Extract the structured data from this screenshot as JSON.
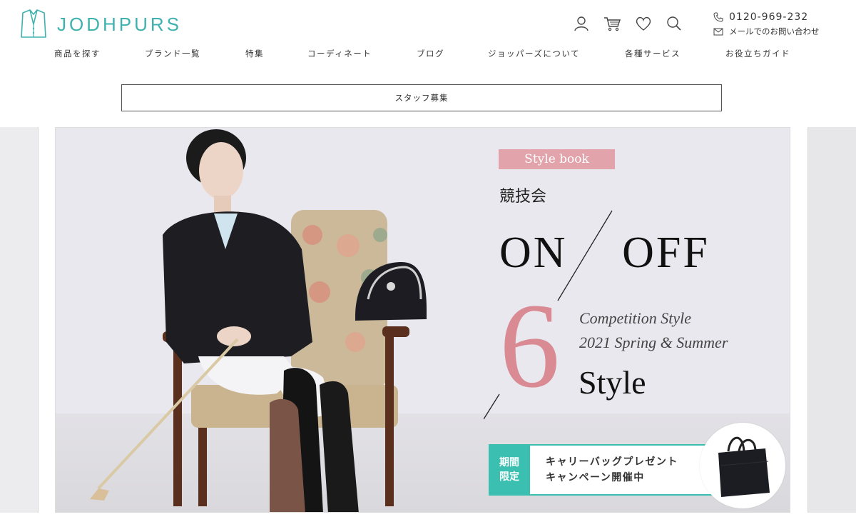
{
  "header": {
    "logo_text": "JODHPURS",
    "icons": [
      "user-icon",
      "cart-icon",
      "heart-icon",
      "search-icon"
    ],
    "phone": "0120-969-232",
    "mail_label": "メールでのお問い合わせ"
  },
  "nav": {
    "items": [
      "商品を探す",
      "ブランド一覧",
      "特集",
      "コーディネート",
      "ブログ",
      "ジョッパーズについて",
      "各種サービス",
      "お役立ちガイド"
    ]
  },
  "staff_button": "スタッフ募集",
  "slide": {
    "badge": "Style book",
    "subtitle": "競技会",
    "on": "ON",
    "off": "OFF",
    "number": "6",
    "comp_line1": "Competition Style",
    "comp_line2": "2021 Spring & Summer",
    "style_word": "Style",
    "promo_tag_line1": "期間",
    "promo_tag_line2": "限定",
    "promo_line1": "キャリーバッグプレゼント",
    "promo_line2": "キャンペーン開催中"
  },
  "colors": {
    "brand": "#3fb2b0",
    "accent_pink": "#e2a3ab",
    "number_pink": "#d98a93",
    "promo_teal": "#3bbfb0"
  }
}
